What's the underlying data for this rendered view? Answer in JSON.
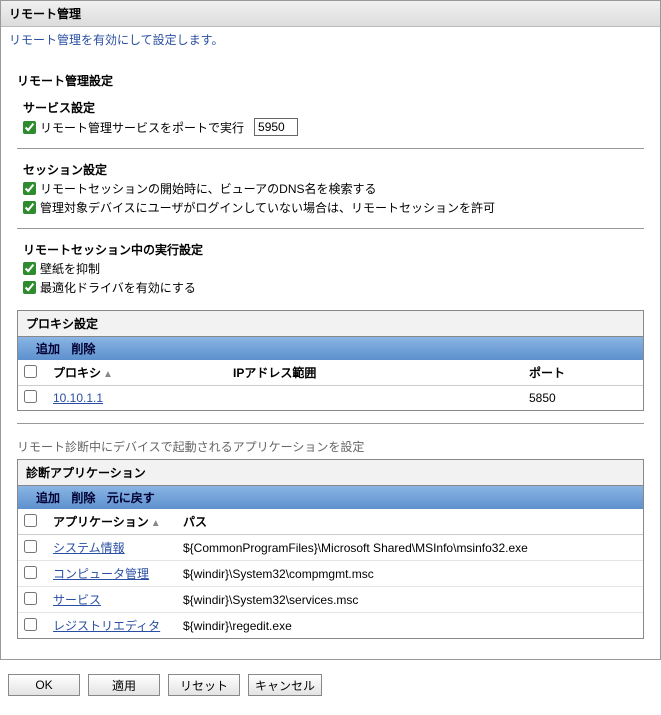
{
  "header": {
    "title": "リモート管理",
    "subtitle": "リモート管理を有効にして設定します。"
  },
  "section_title": "リモート管理設定",
  "service": {
    "heading": "サービス設定",
    "run_on_port_label": "リモート管理サービスをポートで実行",
    "run_on_port_checked": true,
    "port_value": "5950"
  },
  "session": {
    "heading": "セッション設定",
    "options": [
      {
        "label": "リモートセッションの開始時に、ビューアのDNS名を検索する",
        "checked": true
      },
      {
        "label": "管理対象デバイスにユーザがログインしていない場合は、リモートセッションを許可",
        "checked": true
      }
    ]
  },
  "during": {
    "heading": "リモートセッション中の実行設定",
    "options": [
      {
        "label": "壁紙を抑制",
        "checked": true
      },
      {
        "label": "最適化ドライバを有効にする",
        "checked": true
      }
    ]
  },
  "proxy": {
    "title": "プロキシ設定",
    "actions": {
      "add": "追加",
      "delete": "削除"
    },
    "columns": {
      "proxy": "プロキシ",
      "ip_range": "IPアドレス範囲",
      "port": "ポート"
    },
    "rows": [
      {
        "proxy": "10.10.1.1",
        "ip_range": "",
        "port": "5850"
      }
    ]
  },
  "apps_note": "リモート診断中にデバイスで起動されるアプリケーションを設定",
  "apps": {
    "title": "診断アプリケーション",
    "actions": {
      "add": "追加",
      "delete": "削除",
      "revert": "元に戻す"
    },
    "columns": {
      "app": "アプリケーション",
      "path": "パス"
    },
    "rows": [
      {
        "app": "システム情報",
        "path": "${CommonProgramFiles}\\Microsoft Shared\\MSInfo\\msinfo32.exe"
      },
      {
        "app": "コンピュータ管理",
        "path": "${windir}\\System32\\compmgmt.msc"
      },
      {
        "app": "サービス",
        "path": "${windir}\\System32\\services.msc"
      },
      {
        "app": "レジストリエディタ",
        "path": "${windir}\\regedit.exe"
      }
    ]
  },
  "buttons": {
    "ok": "OK",
    "apply": "適用",
    "reset": "リセット",
    "cancel": "キャンセル"
  }
}
